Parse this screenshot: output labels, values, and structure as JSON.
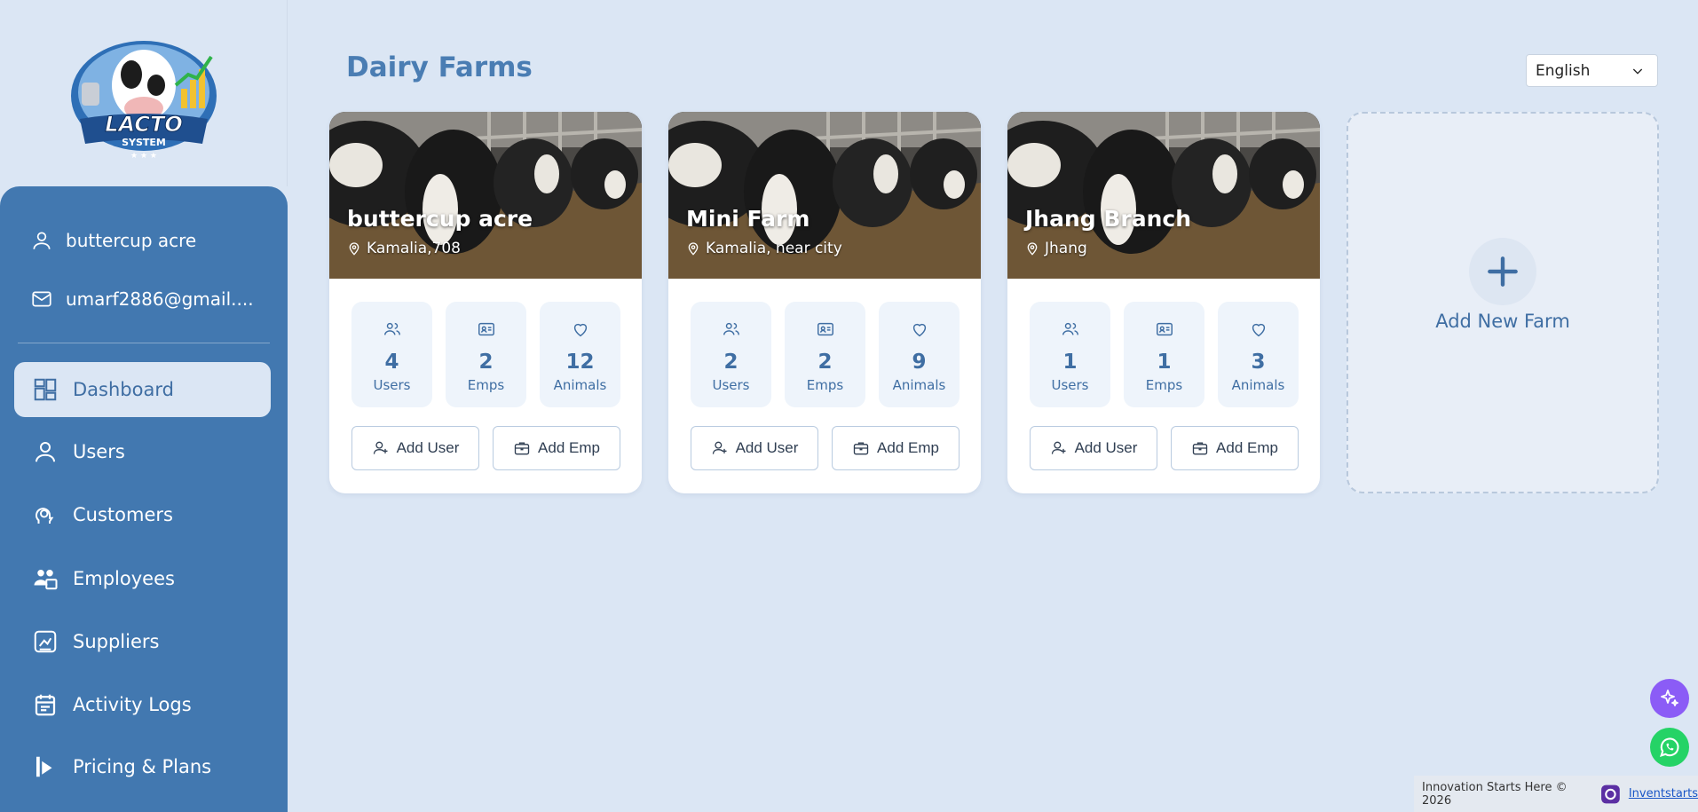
{
  "app": {
    "logo_line1": "LACTO",
    "logo_line2": "SYSTEM"
  },
  "sidebar": {
    "profile": {
      "name": "buttercup acre",
      "email": "umarf2886@gmail...."
    },
    "nav": [
      {
        "label": "Dashboard",
        "icon": "dashboard-icon",
        "active": true
      },
      {
        "label": "Users",
        "icon": "user-icon"
      },
      {
        "label": "Customers",
        "icon": "customers-icon"
      },
      {
        "label": "Employees",
        "icon": "employees-icon"
      },
      {
        "label": "Suppliers",
        "icon": "suppliers-icon"
      },
      {
        "label": "Activity Logs",
        "icon": "calendar-icon"
      },
      {
        "label": "Pricing & Plans",
        "icon": "pricing-icon"
      }
    ]
  },
  "header": {
    "title": "Dairy Farms",
    "language": "English"
  },
  "farms": [
    {
      "name": "buttercup acre",
      "location": "Kamalia,708",
      "users": "4",
      "emps": "2",
      "animals": "12"
    },
    {
      "name": "Mini Farm",
      "location": "Kamalia, near city",
      "users": "2",
      "emps": "2",
      "animals": "9"
    },
    {
      "name": "Jhang Branch",
      "location": "Jhang",
      "users": "1",
      "emps": "1",
      "animals": "3"
    }
  ],
  "labels": {
    "users": "Users",
    "emps": "Emps",
    "animals": "Animals",
    "add_user": "Add User",
    "add_emp": "Add Emp",
    "add_new_farm": "Add New Farm"
  },
  "footer": {
    "text": "Innovation Starts Here © 2026",
    "link": "Inventstarts"
  },
  "colors": {
    "sidebar": "#4278b0",
    "background": "#dbe6f4",
    "accent": "#3f6ea3",
    "ai_button": "#8b5cf6",
    "whatsapp": "#25d366"
  }
}
